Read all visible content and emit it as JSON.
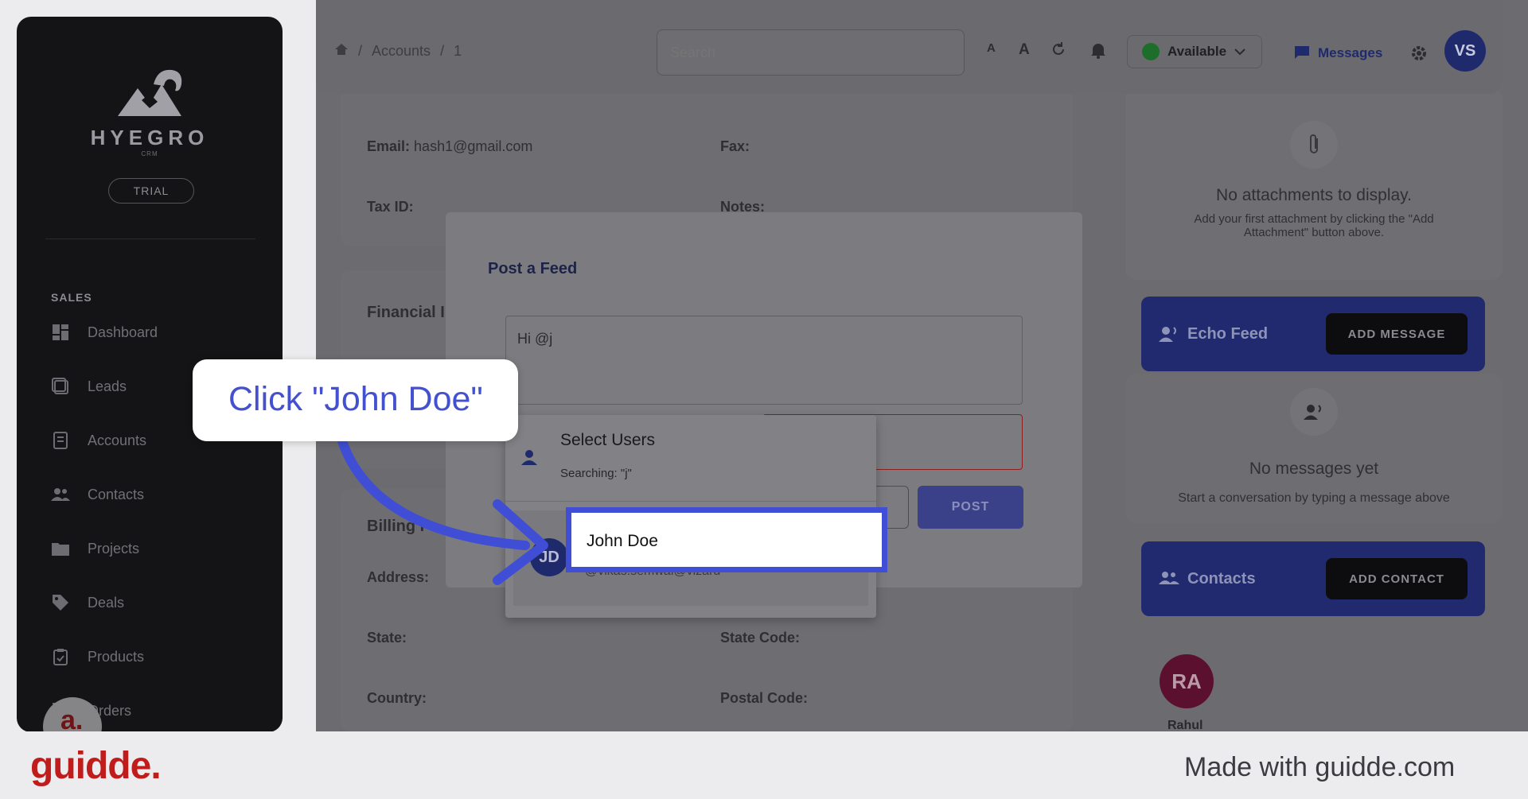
{
  "sidebar": {
    "brand": "HYEGRO",
    "brand_sub": "CRM",
    "plan_badge": "TRIAL",
    "section": "SALES",
    "items": [
      {
        "label": "Dashboard",
        "icon": "dashboard-icon"
      },
      {
        "label": "Leads",
        "icon": "leads-icon"
      },
      {
        "label": "Accounts",
        "icon": "accounts-icon"
      },
      {
        "label": "Contacts",
        "icon": "contacts-icon"
      },
      {
        "label": "Projects",
        "icon": "folder-icon"
      },
      {
        "label": "Deals",
        "icon": "tag-icon"
      },
      {
        "label": "Products",
        "icon": "clipboard-icon"
      },
      {
        "label": "Orders",
        "icon": "cart-icon"
      }
    ]
  },
  "header": {
    "breadcrumb": [
      "Accounts",
      "1"
    ],
    "search_placeholder": "Search",
    "font_small": "A",
    "font_large": "A",
    "status": "Available",
    "messages": "Messages",
    "avatar_initials": "VS"
  },
  "account": {
    "email_label": "Email:",
    "email_value": "hash1@gmail.com",
    "fax_label": "Fax:",
    "tax_label": "Tax ID:",
    "notes_label": "Notes:",
    "financial_title": "Financial I",
    "billing_title": "Billing I",
    "address_label": "Address:",
    "state_label": "State:",
    "state_code_label": "State Code:",
    "country_label": "Country:",
    "postal_label": "Postal Code:"
  },
  "right": {
    "attachments_empty": "No attachments to display.",
    "attachments_hint": "Add your first attachment by clicking the \"Add Attachment\" button above.",
    "echo_title": "Echo Feed",
    "echo_button": "ADD MESSAGE",
    "messages_empty": "No messages yet",
    "messages_hint": "Start a conversation by typing a message above",
    "contacts_title": "Contacts",
    "contacts_button": "ADD CONTACT",
    "contact_initials": "RA",
    "contact_name": "Rahul"
  },
  "modal": {
    "title": "Post a Feed",
    "text_value": "Hi @j",
    "post_button": "POST",
    "dropdown": {
      "title": "Select Users",
      "subtitle": "Searching: \"j\"",
      "option_initials": "JD",
      "option_name": "John Doe",
      "option_handle": "@vikas.semwal@vizard"
    }
  },
  "guide": {
    "callout": "Click \"John Doe\"",
    "highlight_color": "#3f4ed4",
    "assistant_glyph": "a."
  },
  "footer": {
    "logo": "guidde.",
    "made_with": "Made with guidde.com"
  }
}
